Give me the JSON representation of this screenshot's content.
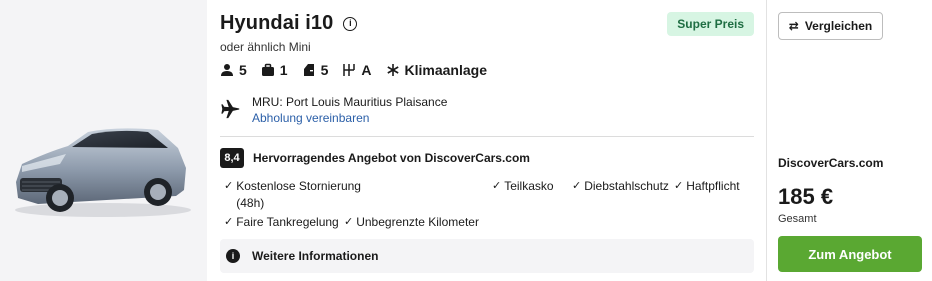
{
  "car": {
    "title": "Hyundai i10",
    "subtitle": "oder ähnlich Mini",
    "badge": "Super Preis",
    "info_glyph": "i"
  },
  "specs": {
    "seats": "5",
    "bags": "1",
    "doors": "5",
    "transmission": "A",
    "aircon": "Klimaanlage"
  },
  "location": {
    "name": "MRU: Port Louis Mauritius Plaisance",
    "pickup_link": "Abholung vereinbaren"
  },
  "rating": {
    "score": "8,4",
    "label": "Hervorragendes Angebot von DiscoverCars.com"
  },
  "features": {
    "check_glyph": "✓",
    "cancellation": "Kostenlose Stornierung",
    "cancellation_note": "(48h)",
    "partial_cover": "Teilkasko",
    "theft": "Diebstahlschutz",
    "liability": "Haftpflicht",
    "fuel": "Faire Tankregelung",
    "mileage": "Unbegrenzte Kilometer"
  },
  "more_info": {
    "label": "Weitere Informationen",
    "icon_glyph": "i"
  },
  "sidebar": {
    "compare_label": "Vergleichen",
    "compare_glyph": "⇄",
    "supplier": "DiscoverCars.com",
    "price": "185 €",
    "price_note": "Gesamt",
    "cta_label": "Zum Angebot"
  },
  "colors": {
    "badge_bg": "#d7f5e3",
    "badge_text": "#1f6e43",
    "cta": "#5aa832",
    "link": "#2b5fa8"
  },
  "icons": [
    "person-icon",
    "suitcase-icon",
    "door-icon",
    "gearshift-icon",
    "snowflake-icon",
    "airplane-icon",
    "info-icon",
    "swap-arrows-icon"
  ]
}
